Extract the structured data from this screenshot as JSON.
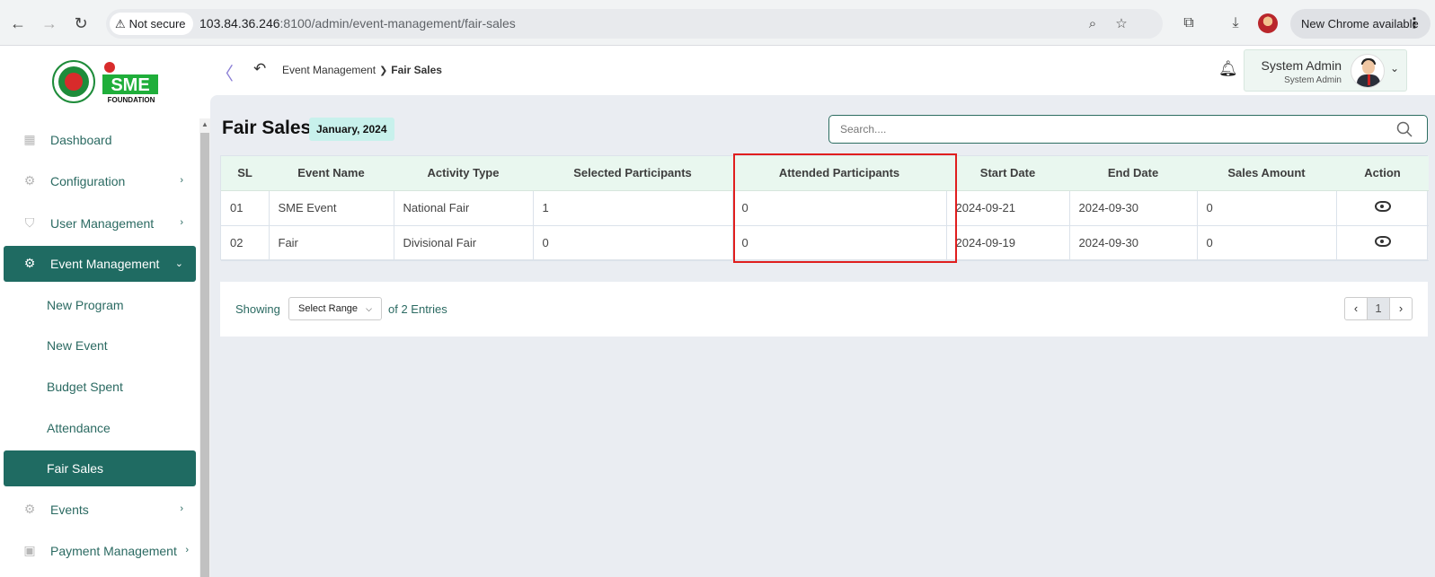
{
  "browser": {
    "security_label": "Not secure",
    "url_host": "103.84.36.246",
    "url_path": ":8100/admin/event-management/fair-sales",
    "update_label": "New Chrome available"
  },
  "header": {
    "logo_text": "SME",
    "logo_subtext": "FOUNDATION",
    "breadcrumb_parent": "Event Management",
    "breadcrumb_current": "Fair Sales",
    "user_name": "System Admin",
    "user_role": "System Admin"
  },
  "sidebar": {
    "items": [
      {
        "label": "Dashboard",
        "icon": "grid-icon"
      },
      {
        "label": "Configuration",
        "icon": "config-icon"
      },
      {
        "label": "User Management",
        "icon": "shield-icon"
      },
      {
        "label": "Event Management",
        "icon": "gear-icon"
      },
      {
        "label": "Events",
        "icon": "gear-icon"
      },
      {
        "label": "Payment Management",
        "icon": "payment-icon"
      }
    ],
    "sub_items": [
      "New Program",
      "New Event",
      "Budget Spent",
      "Attendance",
      "Fair Sales"
    ]
  },
  "page": {
    "title": "Fair Sales",
    "period": "January, 2024",
    "search_placeholder": "Search...."
  },
  "table": {
    "headers": [
      "SL",
      "Event Name",
      "Activity Type",
      "Selected Participants",
      "Attended Participants",
      "Start Date",
      "End Date",
      "Sales Amount",
      "Action"
    ],
    "rows": [
      [
        "01",
        "SME Event",
        "National Fair",
        "1",
        "0",
        "2024-09-21",
        "2024-09-30",
        "0"
      ],
      [
        "02",
        "Fair",
        "Divisional Fair",
        "0",
        "0",
        "2024-09-19",
        "2024-09-30",
        "0"
      ]
    ]
  },
  "pagination": {
    "showing_label": "Showing",
    "range_label": "Select Range",
    "entries_label": "of 2 Entries",
    "current_page": "1"
  },
  "colors": {
    "primary": "#1f6b62",
    "highlight": "#e01e1e",
    "badge": "#c8f1ec"
  }
}
